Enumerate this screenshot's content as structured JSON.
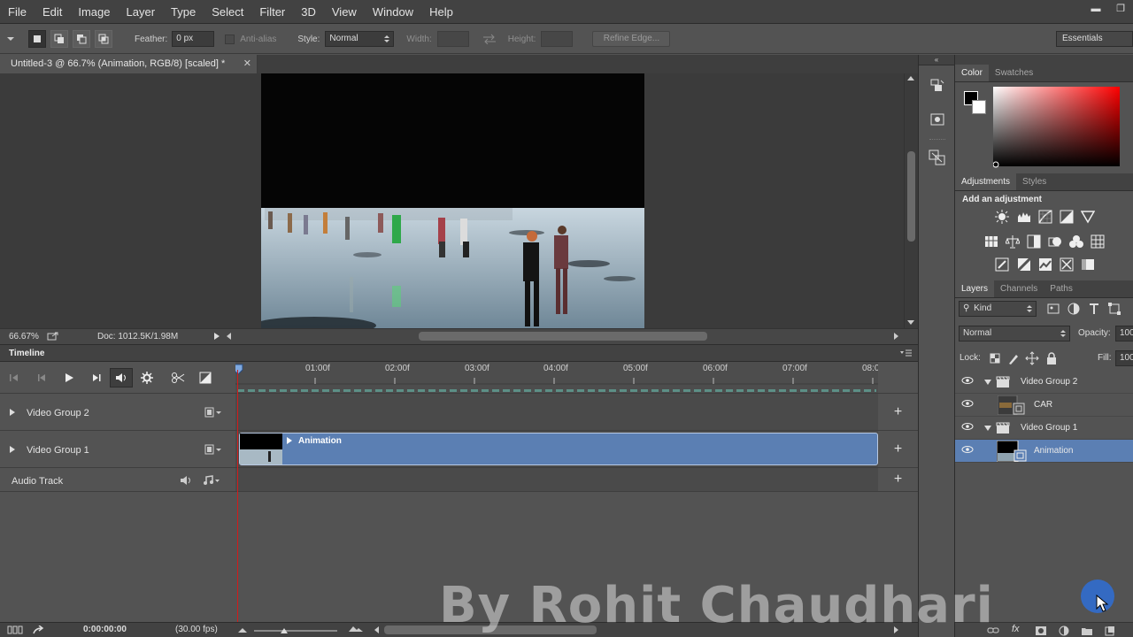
{
  "menu": [
    "File",
    "Edit",
    "Image",
    "Layer",
    "Type",
    "Select",
    "Filter",
    "3D",
    "View",
    "Window",
    "Help"
  ],
  "options_bar": {
    "feather_label": "Feather:",
    "feather_value": "0 px",
    "antialias_label": "Anti-alias",
    "style_label": "Style:",
    "style_value": "Normal",
    "width_label": "Width:",
    "height_label": "Height:",
    "refine_edge": "Refine Edge...",
    "workspace": "Essentials"
  },
  "document": {
    "tab_title": "Untitled-3 @ 66.7% (Animation, RGB/8) [scaled] *",
    "zoom": "66.67%",
    "doc_size": "Doc: 1012.5K/1.98M"
  },
  "timeline": {
    "title": "Timeline",
    "ruler_ticks": [
      "01:00f",
      "02:00f",
      "03:00f",
      "04:00f",
      "05:00f",
      "06:00f",
      "07:00f",
      "08:0"
    ],
    "tracks": {
      "group2": "Video Group 2",
      "group1": "Video Group 1",
      "audio": "Audio Track"
    },
    "clip_name": "Animation",
    "timecode": "0:00:00:00",
    "fps": "(30.00 fps)"
  },
  "panels": {
    "color_tab": "Color",
    "swatches_tab": "Swatches",
    "adjustments_tab": "Adjustments",
    "styles_tab": "Styles",
    "add_adjustment": "Add an adjustment",
    "layers_tab": "Layers",
    "channels_tab": "Channels",
    "paths_tab": "Paths",
    "kind_filter": "Kind",
    "blend_mode": "Normal",
    "opacity_label": "Opacity:",
    "opacity_value": "100",
    "lock_label": "Lock:",
    "fill_label": "Fill:",
    "fill_value": "100"
  },
  "layers": {
    "group2": "Video Group 2",
    "car": "CAR",
    "group1": "Video Group 1",
    "animation": "Animation"
  },
  "watermark": "By Rohit Chaudhari",
  "colors": {
    "clip_blue": "#5b7fb3",
    "selected_layer": "#5b7fb3",
    "playhead_red": "#d11c1c"
  }
}
